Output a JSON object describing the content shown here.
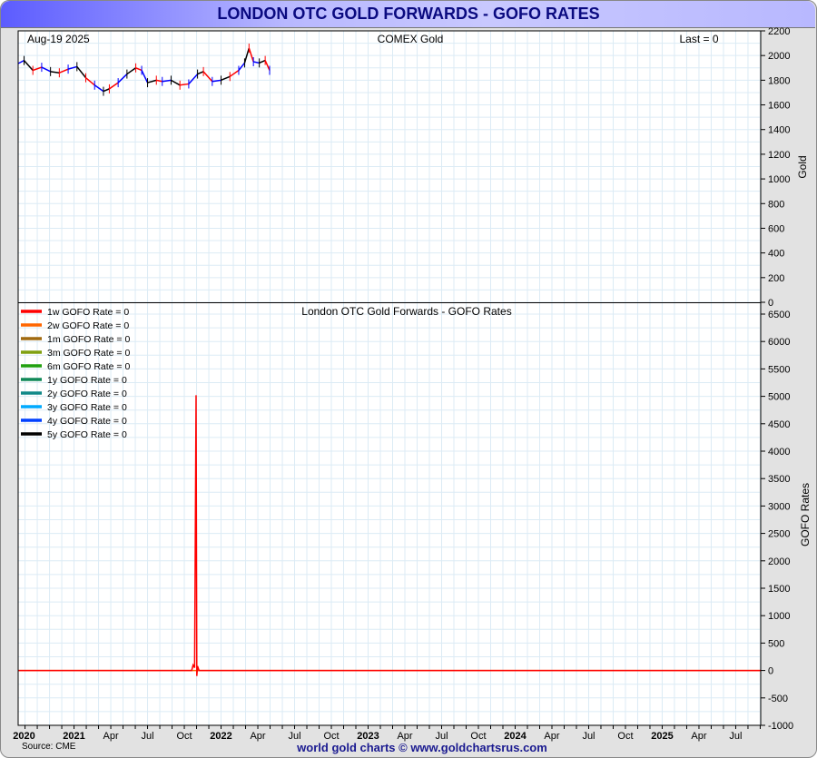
{
  "title": "LONDON OTC GOLD FORWARDS - GOFO RATES",
  "source": "Source: CME",
  "credit": "world gold charts © www.goldchartsrus.com",
  "chart_data": [
    {
      "type": "line",
      "panel": "top",
      "title": "COMEX Gold",
      "date_label": "Aug-19 2025",
      "last_label": "Last = 0",
      "ylabel": "Gold",
      "ylim": [
        0,
        2200
      ],
      "yticks": [
        0,
        200,
        400,
        600,
        800,
        1000,
        1200,
        1400,
        1600,
        1800,
        2000,
        2200
      ],
      "xlim": [
        2020.62,
        2025.67
      ],
      "series": [
        {
          "name": "COMEX Gold",
          "x": [
            2020.62,
            2020.66,
            2020.72,
            2020.78,
            2020.84,
            2020.9,
            2020.96,
            2021.02,
            2021.08,
            2021.14,
            2021.2,
            2021.24,
            2021.3,
            2021.36,
            2021.42,
            2021.46,
            2021.5,
            2021.56,
            2021.6,
            2021.66,
            2021.72,
            2021.78,
            2021.84,
            2021.88,
            2021.94,
            2022.0,
            2022.06,
            2022.12,
            2022.16,
            2022.19,
            2022.22,
            2022.26,
            2022.3,
            2022.33
          ],
          "values": [
            1935,
            1960,
            1880,
            1905,
            1870,
            1860,
            1890,
            1910,
            1820,
            1760,
            1710,
            1730,
            1780,
            1850,
            1900,
            1880,
            1780,
            1800,
            1790,
            1800,
            1760,
            1770,
            1850,
            1870,
            1790,
            1800,
            1830,
            1880,
            1940,
            2060,
            1950,
            1940,
            1960,
            1880
          ]
        }
      ]
    },
    {
      "type": "line",
      "panel": "bottom",
      "title": "London OTC Gold Forwards - GOFO Rates",
      "ylabel": "GOFO Rates",
      "ylim": [
        -1000,
        6500
      ],
      "yticks": [
        -1000,
        -500,
        0,
        500,
        1000,
        1500,
        2000,
        2500,
        3000,
        3500,
        4000,
        4500,
        5000,
        5500,
        6000,
        6500
      ],
      "xlim": [
        2020.62,
        2025.67
      ],
      "x_tick_labels": [
        "2020",
        "2021",
        "Apr",
        "Jul",
        "Oct",
        "2022",
        "Apr",
        "Jul",
        "Oct",
        "2023",
        "Apr",
        "Jul",
        "Oct",
        "2024",
        "Apr",
        "Jul",
        "Oct",
        "2025",
        "Apr",
        "Jul"
      ],
      "x_tick_values": [
        2020.66,
        2021.0,
        2021.25,
        2021.5,
        2021.75,
        2022.0,
        2022.25,
        2022.5,
        2022.75,
        2023.0,
        2023.25,
        2023.5,
        2023.75,
        2024.0,
        2024.25,
        2024.5,
        2024.75,
        2025.0,
        2025.25,
        2025.5
      ],
      "legend": [
        {
          "label": "1w GOFO Rate = 0",
          "color": "#ff0000"
        },
        {
          "label": "2w GOFO Rate = 0",
          "color": "#ff6600"
        },
        {
          "label": "1m GOFO Rate  = 0",
          "color": "#a06a10"
        },
        {
          "label": "3m GOFO Rate  = 0",
          "color": "#80a010"
        },
        {
          "label": "6m GOFO Rate  = 0",
          "color": "#20a010"
        },
        {
          "label": "1y GOFO Rate  = 0",
          "color": "#108858"
        },
        {
          "label": "2y GOFO Rate  = 0",
          "color": "#108888"
        },
        {
          "label": "3y GOFO Rate  = 0",
          "color": "#00aaff"
        },
        {
          "label": "4y GOFO Rate  = 0",
          "color": "#0040ff"
        },
        {
          "label": "5y GOFO Rate  = 0",
          "color": "#000000"
        }
      ],
      "series": [
        {
          "name": "1w GOFO Rate",
          "color": "#ff0000",
          "x": [
            2020.62,
            2021.8,
            2021.81,
            2021.82,
            2021.83,
            2021.835,
            2021.84,
            2021.85,
            2021.86,
            2025.67
          ],
          "values": [
            0,
            0,
            100,
            50,
            5020,
            -100,
            80,
            0,
            0,
            0
          ]
        },
        {
          "name": "2w GOFO Rate",
          "color": "#ff6600",
          "x": [
            2020.62,
            2025.67
          ],
          "values": [
            0,
            0
          ]
        }
      ]
    }
  ]
}
